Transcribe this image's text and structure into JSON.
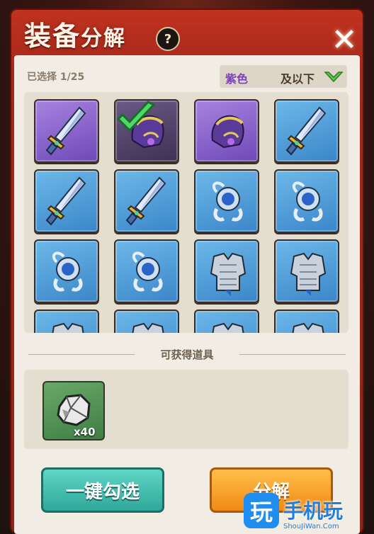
{
  "window": {
    "title_main": "装备",
    "title_sub": "分解",
    "help_label": "?",
    "close_label": "✕"
  },
  "selection": {
    "count_text": "已选择 1/25"
  },
  "filter": {
    "value": "紫色",
    "suffix": "及以下",
    "arrow_icon": "chevron-down-icon",
    "value_color": "#7a3fbf"
  },
  "inventory": {
    "rows": [
      [
        {
          "item": "sword",
          "rarity": "purple",
          "selected": false
        },
        {
          "item": "helmet",
          "rarity": "purple",
          "selected": true
        },
        {
          "item": "helmet",
          "rarity": "purple",
          "selected": false
        },
        {
          "item": "sword",
          "rarity": "blue",
          "selected": false
        }
      ],
      [
        {
          "item": "sword",
          "rarity": "blue",
          "selected": false
        },
        {
          "item": "sword",
          "rarity": "blue",
          "selected": false
        },
        {
          "item": "amulet",
          "rarity": "blue",
          "selected": false
        },
        {
          "item": "amulet",
          "rarity": "blue",
          "selected": false
        }
      ],
      [
        {
          "item": "amulet",
          "rarity": "blue",
          "selected": false
        },
        {
          "item": "amulet",
          "rarity": "blue",
          "selected": false
        },
        {
          "item": "armor",
          "rarity": "blue",
          "selected": false
        },
        {
          "item": "armor",
          "rarity": "blue",
          "selected": false
        }
      ],
      [
        {
          "item": "armor",
          "rarity": "blue",
          "selected": false
        },
        {
          "item": "armor",
          "rarity": "blue",
          "selected": false
        },
        {
          "item": "armor",
          "rarity": "blue",
          "selected": false
        },
        {
          "item": "armor",
          "rarity": "blue",
          "selected": false
        }
      ]
    ]
  },
  "rewards": {
    "title": "可获得道具",
    "items": [
      {
        "icon": "ore-stone-icon",
        "count": "x40"
      }
    ]
  },
  "actions": {
    "auto_select_label": "一键勾选",
    "decompose_label": "分解"
  },
  "watermark": {
    "badge": "玩",
    "text": "手机玩",
    "url": "ShouJiWan.Com"
  }
}
